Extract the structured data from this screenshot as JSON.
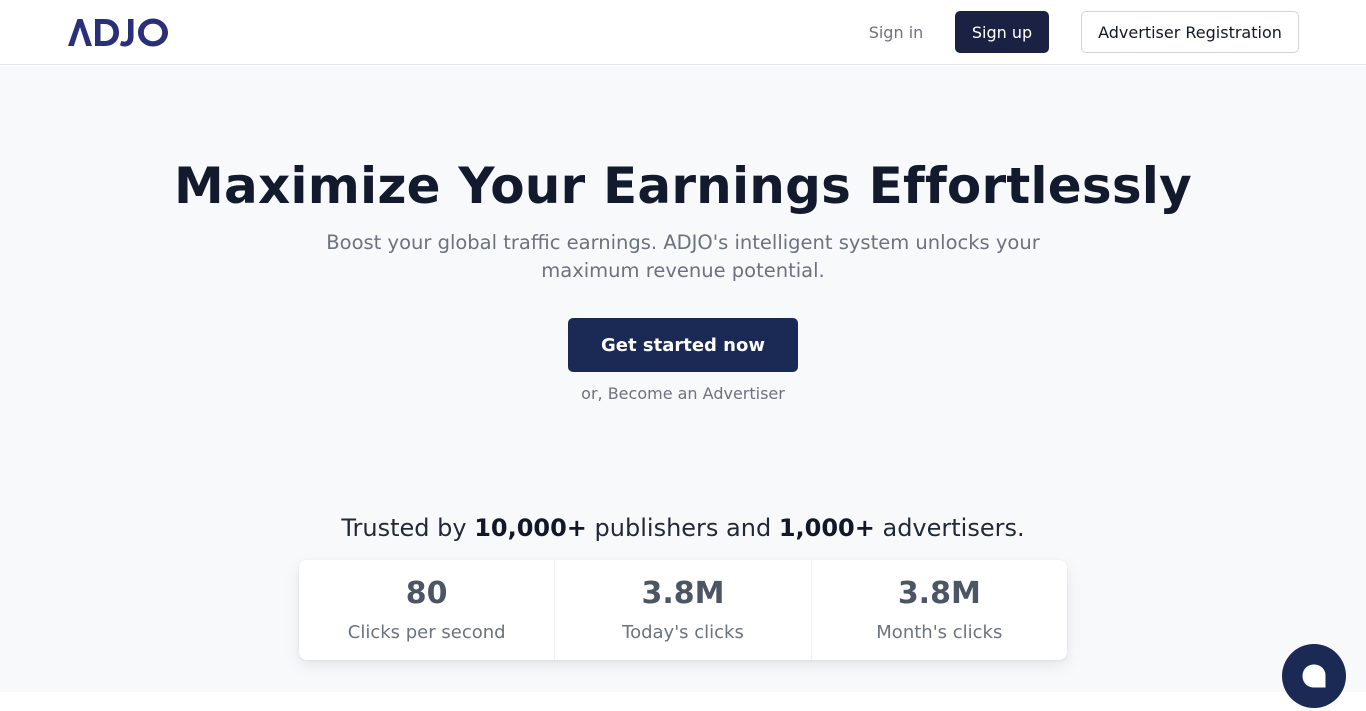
{
  "header": {
    "logo_text": "ADJO",
    "brand_color": "#2a2f7a",
    "signin_label": "Sign in",
    "signup_label": "Sign up",
    "advertiser_label": "Advertiser Registration"
  },
  "hero": {
    "title": "Maximize Your Earnings Effortlessly",
    "subtitle": "Boost your global traffic earnings. ADJO's intelligent system unlocks your maximum revenue potential.",
    "cta_label": "Get started now",
    "cta_sub": "or, Become an Advertiser"
  },
  "trusted": {
    "prefix": "Trusted by ",
    "publishers_count": "10,000+",
    "middle": " publishers and ",
    "advertisers_count": "1,000+",
    "suffix": " advertisers."
  },
  "stats": [
    {
      "value": "80",
      "label": "Clicks per second"
    },
    {
      "value": "3.8M",
      "label": "Today's clicks"
    },
    {
      "value": "3.8M",
      "label": "Month's clicks"
    }
  ],
  "chat": {
    "icon": "chat-bubble-icon"
  },
  "colors": {
    "primary_dark": "#1b2143",
    "cta": "#1b2a55",
    "hero_bg": "#f8f9fb",
    "muted_text": "#6b7280"
  }
}
